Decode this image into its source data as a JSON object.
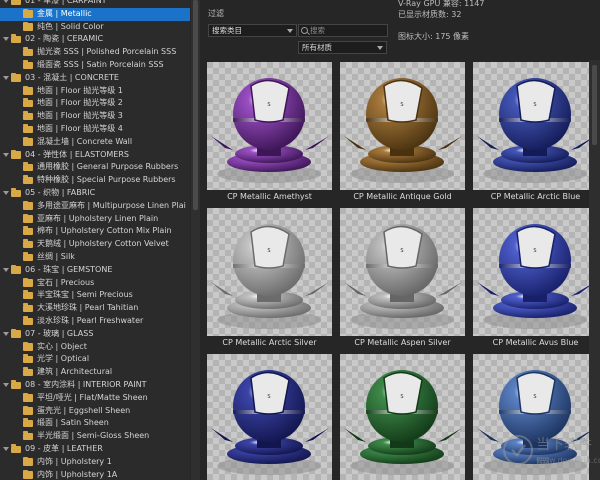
{
  "tree": {
    "items": [
      {
        "label": "01 - 车漆 | CARPAINT",
        "type": "category"
      },
      {
        "label": "金属 | Metallic",
        "type": "item",
        "selected": true
      },
      {
        "label": "纯色 | Solid Color",
        "type": "item"
      },
      {
        "label": "02 - 陶瓷 | CERAMIC",
        "type": "category"
      },
      {
        "label": "抛光瓷 SSS | Polished Porcelain SSS",
        "type": "item"
      },
      {
        "label": "缎面瓷 SSS | Satin Porcelain SSS",
        "type": "item"
      },
      {
        "label": "03 - 混凝土 | CONCRETE",
        "type": "category"
      },
      {
        "label": "地面 | Floor 抛光等级 1",
        "type": "item"
      },
      {
        "label": "地面 | Floor 抛光等级 2",
        "type": "item"
      },
      {
        "label": "地面 | Floor 抛光等级 3",
        "type": "item"
      },
      {
        "label": "地面 | Floor 抛光等级 4",
        "type": "item"
      },
      {
        "label": "混凝土墙 | Concrete Wall",
        "type": "item"
      },
      {
        "label": "04 - 弹性体 | ELASTOMERS",
        "type": "category"
      },
      {
        "label": "通用橡胶 | General Purpose Rubbers",
        "type": "item"
      },
      {
        "label": "特种橡胶 | Special Purpose Rubbers",
        "type": "item"
      },
      {
        "label": "05 - 织物 | FABRIC",
        "type": "category"
      },
      {
        "label": "多用途亚麻布 | Multipurpose Linen Plai",
        "type": "item"
      },
      {
        "label": "亚麻布 | Upholstery Linen Plain",
        "type": "item"
      },
      {
        "label": "棉布 | Upholstery Cotton Mix Plain",
        "type": "item"
      },
      {
        "label": "天鹅绒 | Upholstery Cotton Velvet",
        "type": "item"
      },
      {
        "label": "丝绸 | Silk",
        "type": "item"
      },
      {
        "label": "06 - 珠宝 | GEMSTONE",
        "type": "category"
      },
      {
        "label": "宝石 | Precious",
        "type": "item"
      },
      {
        "label": "半宝珠宝 | Semi Precious",
        "type": "item"
      },
      {
        "label": "大溪地珍珠 | Pearl Tahitian",
        "type": "item"
      },
      {
        "label": "淡水珍珠 | Pearl Freshwater",
        "type": "item"
      },
      {
        "label": "07 - 玻璃 | GLASS",
        "type": "category"
      },
      {
        "label": "实心 | Object",
        "type": "item"
      },
      {
        "label": "光学 | Optical",
        "type": "item"
      },
      {
        "label": "建筑 | Architectural",
        "type": "item"
      },
      {
        "label": "08 - 室内涂料 | INTERIOR PAINT",
        "type": "category"
      },
      {
        "label": "平坦/哑光 | Flat/Matte Sheen",
        "type": "item"
      },
      {
        "label": "蛋壳光 | Eggshell Sheen",
        "type": "item"
      },
      {
        "label": "缎面 | Satin Sheen",
        "type": "item"
      },
      {
        "label": "半光缎面 | Semi-Gloss Sheen",
        "type": "item"
      },
      {
        "label": "09 - 皮革 | LEATHER",
        "type": "category"
      },
      {
        "label": "内饰 | Upholstery 1",
        "type": "item"
      },
      {
        "label": "内饰 | Upholstery 1A",
        "type": "item"
      }
    ]
  },
  "filter": {
    "label": "过滤",
    "category_select": "搜索类目",
    "search_placeholder": "搜索",
    "materials_select": "所有材质"
  },
  "info": {
    "gpu": "V-Ray GPU 兼容: 1147",
    "shown": "已显示材质数: 32",
    "thumb": "图标大小: 175 像素"
  },
  "materials": [
    {
      "name": "CP Metallic Amethyst",
      "color": "#9b4fc4",
      "dark": "#3d1656"
    },
    {
      "name": "CP Metallic Antique Gold",
      "color": "#a87a3c",
      "dark": "#4a3210"
    },
    {
      "name": "CP Metallic Arctic Blue",
      "color": "#4457b8",
      "dark": "#141c58"
    },
    {
      "name": "CP Metallic Arctic Silver",
      "color": "#c4c4c4",
      "dark": "#6b6b6b"
    },
    {
      "name": "CP Metallic Aspen Silver",
      "color": "#bfbfbf",
      "dark": "#656565"
    },
    {
      "name": "CP Metallic Avus Blue",
      "color": "#4e5fcc",
      "dark": "#18206a"
    },
    {
      "name": "",
      "color": "#3c44a8",
      "dark": "#12164e"
    },
    {
      "name": "",
      "color": "#3e8a4a",
      "dark": "#123a18"
    },
    {
      "name": "",
      "color": "#5c82c4",
      "dark": "#1c3460"
    }
  ],
  "watermark": {
    "line1": "当下软件园",
    "line2": "www.downxia.com"
  }
}
